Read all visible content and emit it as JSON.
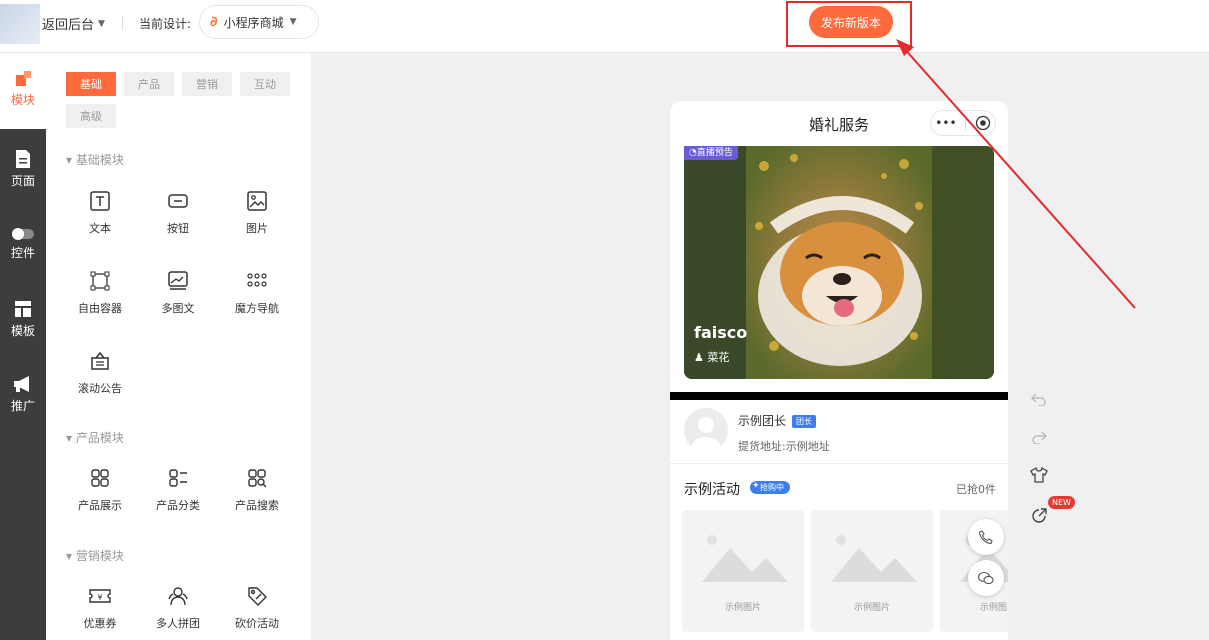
{
  "topbar": {
    "back_label": "返回后台",
    "current_design_label": "当前设计:",
    "design_name": "小程序商城",
    "publish_label": "发布新版本"
  },
  "rail": {
    "items": [
      {
        "label": "模块",
        "icon": "modules-icon"
      },
      {
        "label": "页面",
        "icon": "page-icon"
      },
      {
        "label": "控件",
        "icon": "toggle-icon"
      },
      {
        "label": "模板",
        "icon": "template-icon"
      },
      {
        "label": "推广",
        "icon": "megaphone-icon"
      }
    ]
  },
  "panel": {
    "tabs": [
      "基础",
      "产品",
      "营销",
      "互动",
      "高级"
    ],
    "sections": [
      {
        "title": "基础模块",
        "items": [
          "文本",
          "按钮",
          "图片",
          "自由容器",
          "多图文",
          "魔方导航",
          "滚动公告"
        ]
      },
      {
        "title": "产品模块",
        "items": [
          "产品展示",
          "产品分类",
          "产品搜索"
        ]
      },
      {
        "title": "营销模块",
        "items": [
          "优惠券",
          "多人拼团",
          "砍价活动"
        ]
      }
    ]
  },
  "phone": {
    "title": "婚礼服务",
    "capsule_more": "•••",
    "live_badge": "直播预告",
    "carousel_title": "faisco",
    "carousel_user": "菜花",
    "leader_name": "示例团长",
    "leader_badge": "团长",
    "leader_address": "提货地址:示例地址",
    "activity_title": "示例活动",
    "activity_badge": "抢购中",
    "activity_sold": "已抢0件",
    "card_labels": [
      "示例图片",
      "示例图片",
      "示例图"
    ]
  },
  "side_tools": {
    "new_badge": "NEW"
  },
  "colors": {
    "accent": "#ff6a3d",
    "rail_bg": "#3d3d3d",
    "annotation": "#e32b2b",
    "badge_blue": "#3f7ee8"
  }
}
